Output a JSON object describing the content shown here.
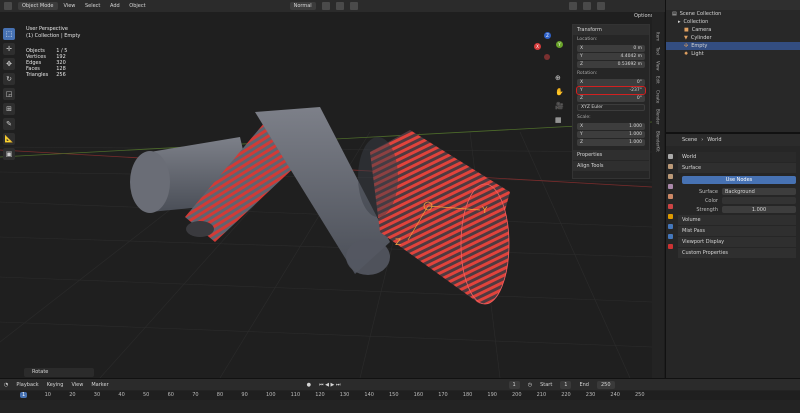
{
  "topbar": {
    "mode": "Object Mode",
    "menu": [
      "View",
      "Select",
      "Add",
      "Object"
    ],
    "orientation": "Normal",
    "options": "Options"
  },
  "viewport": {
    "view_title": "User Perspective",
    "collection_path": "(1) Collection | Empty",
    "stats": [
      {
        "label": "Objects",
        "value": "1 / 5"
      },
      {
        "label": "Vertices",
        "value": "192"
      },
      {
        "label": "Edges",
        "value": "320"
      },
      {
        "label": "Faces",
        "value": "128"
      },
      {
        "label": "Triangles",
        "value": "256"
      }
    ],
    "gizmo": {
      "x": "X",
      "y": "Y",
      "z": "Z"
    },
    "empty_axes": {
      "y": "Y",
      "z": "Z"
    }
  },
  "npanel": {
    "transform_title": "Transform",
    "location_label": "Location:",
    "location": [
      {
        "axis": "X",
        "value": "0 m"
      },
      {
        "axis": "Y",
        "value": "4.4042 m"
      },
      {
        "axis": "Z",
        "value": "0.53692 m"
      }
    ],
    "rotation_label": "Rotation:",
    "rotation": [
      {
        "axis": "X",
        "value": "0°"
      },
      {
        "axis": "Y",
        "value": "-237°"
      },
      {
        "axis": "Z",
        "value": "0°"
      }
    ],
    "rotation_mode": "XYZ Euler",
    "scale_label": "Scale:",
    "scale": [
      {
        "axis": "X",
        "value": "1.000"
      },
      {
        "axis": "Y",
        "value": "1.000"
      },
      {
        "axis": "Z",
        "value": "1.000"
      }
    ],
    "properties": "Properties",
    "align_tools": "Align Tools"
  },
  "sidetabs": [
    "Item",
    "Tool",
    "View",
    "Edit",
    "Create",
    "Blender",
    "BlenderKit"
  ],
  "outliner": {
    "scene_collection": "Scene Collection",
    "items": [
      {
        "label": "Collection",
        "indent": 1,
        "selected": false
      },
      {
        "label": "Camera",
        "indent": 2,
        "selected": false
      },
      {
        "label": "Cylinder",
        "indent": 2,
        "selected": false
      },
      {
        "label": "Empty",
        "indent": 2,
        "selected": true
      },
      {
        "label": "Light",
        "indent": 2,
        "selected": false
      }
    ]
  },
  "properties": {
    "scene": "Scene",
    "world_crumb": "World",
    "world_name": "World",
    "surface_section": "Surface",
    "use_nodes": "Use Nodes",
    "surface_label": "Surface",
    "surface_value": "Background",
    "color_label": "Color",
    "strength_label": "Strength",
    "strength_value": "1.000",
    "sections": [
      "Volume",
      "Mist Pass",
      "Viewport Display",
      "Custom Properties"
    ]
  },
  "rotate_operator": "Rotate",
  "timeline": {
    "menus": [
      "Playback",
      "Keying",
      "View",
      "Marker"
    ],
    "current_frame": "1",
    "start_label": "Start",
    "start": "1",
    "end_label": "End",
    "end": "250",
    "ruler": [
      "1",
      "10",
      "20",
      "30",
      "40",
      "50",
      "60",
      "70",
      "80",
      "90",
      "100",
      "110",
      "120",
      "130",
      "140",
      "150",
      "160",
      "170",
      "180",
      "190",
      "200",
      "210",
      "220",
      "230",
      "240",
      "250"
    ]
  },
  "colors": {
    "accent": "#4772b3",
    "highlight_box": "#d32020",
    "stripe_red": "#d23a36",
    "stripe_gray": "#5f6470"
  }
}
